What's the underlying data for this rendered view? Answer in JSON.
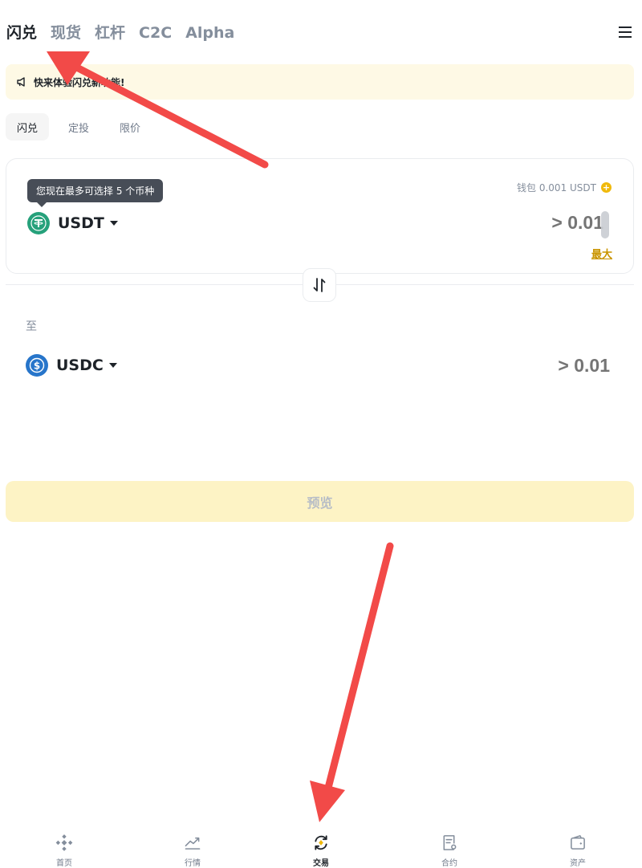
{
  "top_tabs": [
    {
      "label": "闪兑",
      "active": true
    },
    {
      "label": "现货",
      "active": false
    },
    {
      "label": "杠杆",
      "active": false
    },
    {
      "label": "C2C",
      "active": false
    },
    {
      "label": "Alpha",
      "active": false
    }
  ],
  "announcement": {
    "text": "快来体验闪兑新功能!",
    "icon": "megaphone-icon"
  },
  "sub_tabs": [
    {
      "label": "闪兑",
      "active": true
    },
    {
      "label": "定投",
      "active": false
    },
    {
      "label": "限价",
      "active": false
    }
  ],
  "from": {
    "tooltip": "您现在最多可选择 5 个币种",
    "wallet": "钱包 0.001 USDT",
    "coin": "USDT",
    "placeholder": "> 0.01",
    "max_label": "最大"
  },
  "to": {
    "label": "至",
    "coin": "USDC",
    "placeholder": "> 0.01"
  },
  "preview_label": "预览",
  "bottom_nav": [
    {
      "label": "首页",
      "icon": "home-icon"
    },
    {
      "label": "行情",
      "icon": "markets-icon"
    },
    {
      "label": "交易",
      "icon": "trade-icon",
      "active": true
    },
    {
      "label": "合约",
      "icon": "futures-icon"
    },
    {
      "label": "资产",
      "icon": "wallet-icon"
    }
  ],
  "colors": {
    "brand": "#f0b90b",
    "usdt": "#26a17b",
    "usdc": "#2775ca",
    "arrow": "#f24a48"
  }
}
